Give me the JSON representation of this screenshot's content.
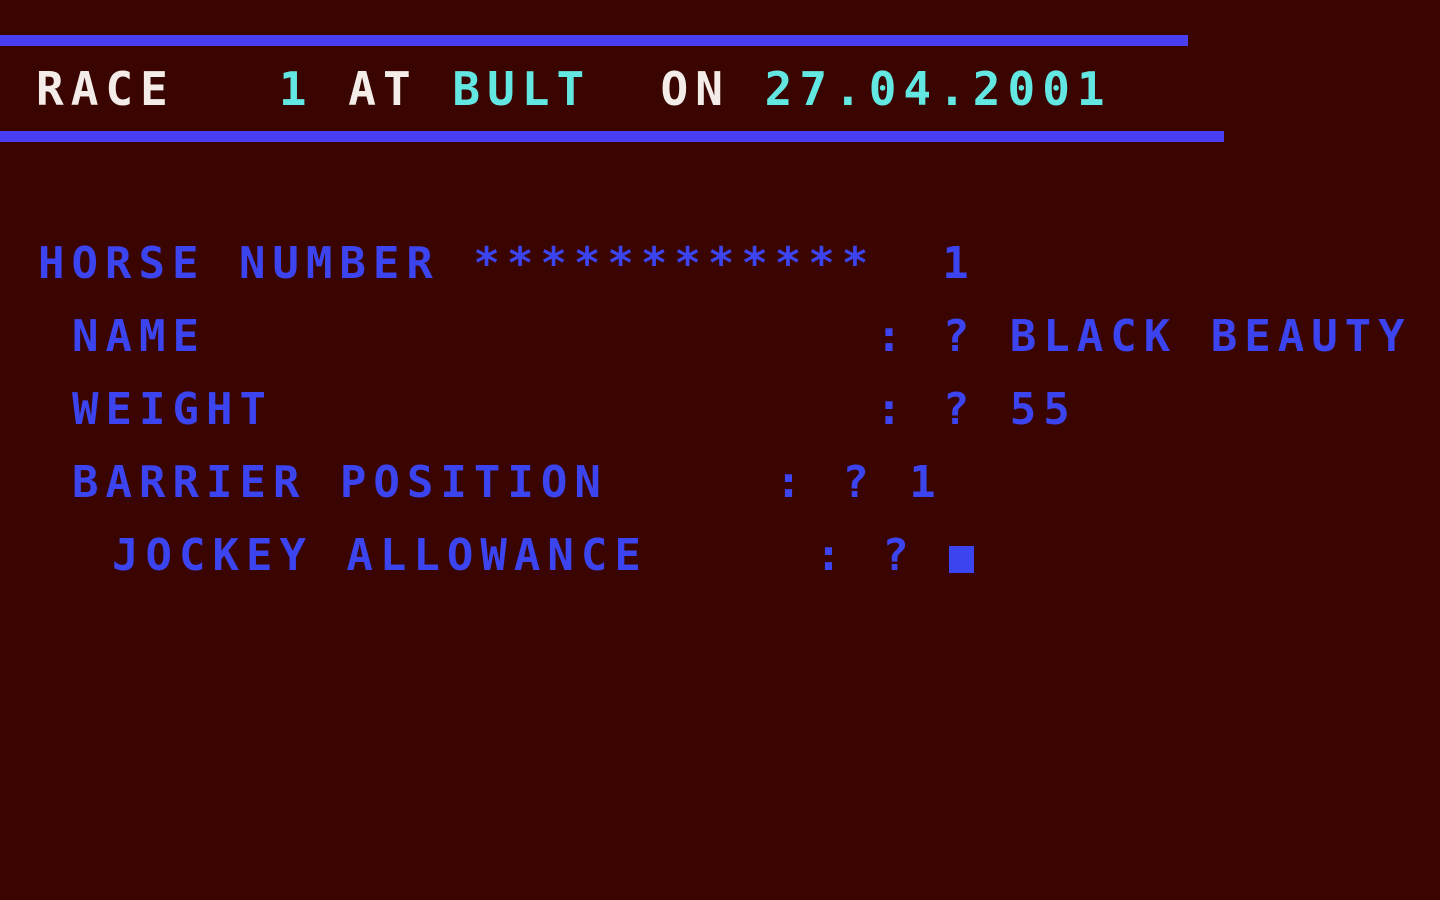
{
  "screen": {
    "background_color": "#3a0400",
    "rule_color": "#4a3ef2",
    "text_color_primary": "#3b44ef",
    "text_color_white": "#f3ece9",
    "text_color_cyan": "#62e7e2"
  },
  "header": {
    "label_race": "RACE",
    "race_number": "1",
    "label_at": "AT",
    "venue": "BULT",
    "label_on": "ON",
    "date": "27.04.2001",
    "gap_after_race": "   ",
    "gap_space": " ",
    "gap_before_on": "  "
  },
  "form": {
    "horse_number_label": "HORSE NUMBER",
    "horse_number_separator": "************",
    "horse_number_gap": "  ",
    "horse_number_value": "1",
    "fields": [
      {
        "label": "NAME",
        "pad": "                    ",
        "colon": ":",
        "prompt": "?",
        "value": "BLACK BEAUTY",
        "indent": "indent-1"
      },
      {
        "label": "WEIGHT",
        "pad": "                  ",
        "colon": ":",
        "prompt": "?",
        "value": "55",
        "indent": "indent-1"
      },
      {
        "label": "BARRIER POSITION",
        "pad": "     ",
        "colon": ":",
        "prompt": "?",
        "value": "1",
        "indent": "indent-1"
      },
      {
        "label": "JOCKEY ALLOWANCE",
        "pad": "     ",
        "colon": ":",
        "prompt": "?",
        "value": "",
        "indent": "indent-2",
        "cursor": true
      }
    ]
  }
}
